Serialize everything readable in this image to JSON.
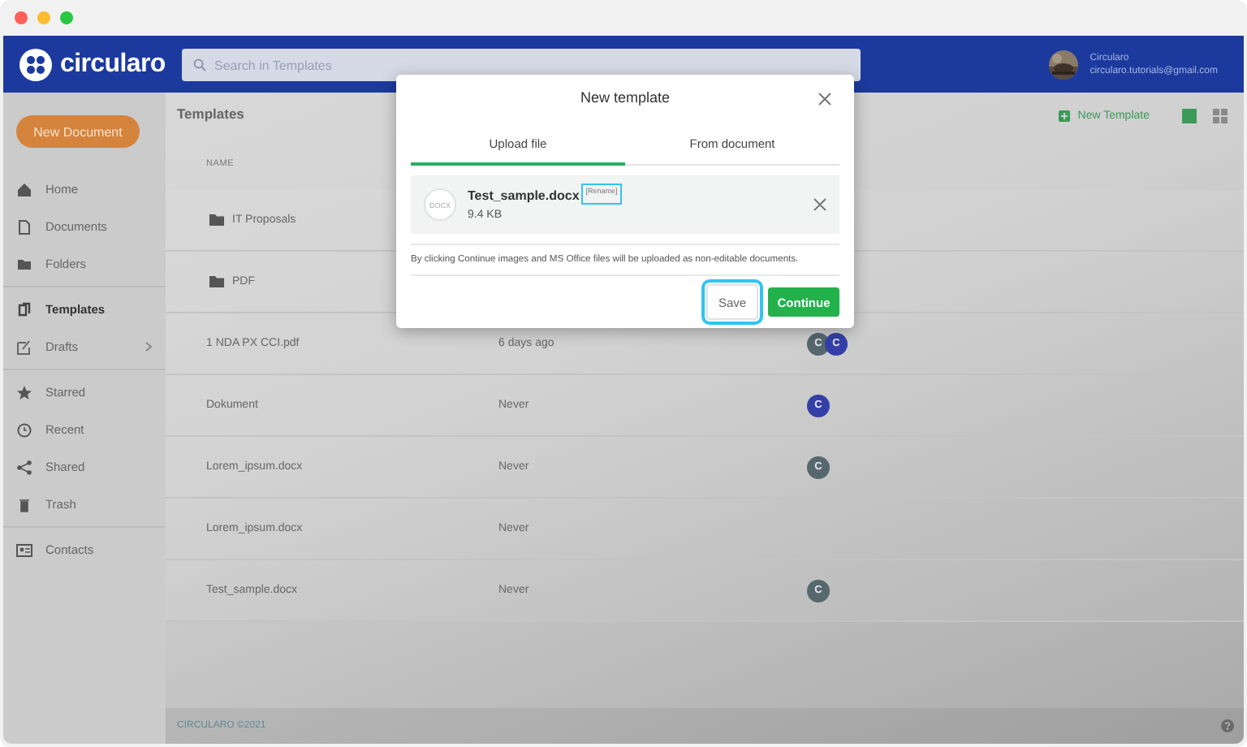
{
  "header": {
    "logo": "circularo",
    "search": {
      "placeholder": "Search in Templates"
    },
    "user": {
      "name": "Circularo",
      "email": "circularo.tutorials@gmail.com"
    }
  },
  "sidebar": {
    "new_button": "New Document",
    "groups": [
      [
        {
          "label": "Home",
          "selected": false,
          "expandable": false
        },
        {
          "label": "Documents",
          "selected": false,
          "expandable": false
        },
        {
          "label": "Folders",
          "selected": false,
          "expandable": false
        }
      ],
      [
        {
          "label": "Templates",
          "selected": true,
          "expandable": false
        },
        {
          "label": "Drafts",
          "selected": false,
          "expandable": true
        }
      ],
      [
        {
          "label": "Starred",
          "selected": false,
          "expandable": false
        },
        {
          "label": "Recent",
          "selected": false,
          "expandable": false
        },
        {
          "label": "Shared",
          "selected": false,
          "expandable": false
        },
        {
          "label": "Trash",
          "selected": false,
          "expandable": false
        }
      ],
      [
        {
          "label": "Contacts",
          "selected": false,
          "expandable": false
        }
      ]
    ]
  },
  "content": {
    "title": "Templates",
    "new_button": "New Template",
    "views": [
      {
        "kind": "list",
        "selected": true
      },
      {
        "kind": "grid",
        "selected": false
      }
    ]
  },
  "table": {
    "columns": [
      "NAME"
    ],
    "rows": [
      {
        "kind": "folder",
        "name": "IT Proposals"
      },
      {
        "kind": "folder",
        "name": "PDF"
      },
      {
        "kind": "file",
        "name": "1 NDA PX CCI.pdf",
        "modified": "6 days ago",
        "shared_with": [
          {
            "initial": "C",
            "color": "#56686e"
          },
          {
            "initial": "C",
            "color": "#3440a8"
          }
        ]
      },
      {
        "kind": "file",
        "name": "Dokument",
        "modified": "Never",
        "shared_with": [
          {
            "initial": "C",
            "color": "#3440a8"
          }
        ]
      },
      {
        "kind": "file",
        "name": "Lorem_ipsum.docx",
        "modified": "Never",
        "shared_with": [
          {
            "initial": "C",
            "color": "#56686e"
          }
        ]
      },
      {
        "kind": "file",
        "name": "Lorem_ipsum.docx",
        "modified": "Never",
        "shared_with": []
      },
      {
        "kind": "file",
        "name": "Test_sample.docx",
        "modified": "Never",
        "shared_with": [
          {
            "initial": "C",
            "color": "#56686e"
          }
        ]
      }
    ]
  },
  "footer": "CIRCULARO ©2021",
  "modal": {
    "title": "New template",
    "tabs": [
      {
        "label": "Upload file",
        "selected": true
      },
      {
        "label": "From document",
        "selected": false
      }
    ],
    "file": {
      "badge": "DOCX",
      "name": "Test_sample.docx",
      "rename": {
        "label": "[Rename]",
        "highlighted": true
      },
      "size": "9.4 KB"
    },
    "note": "By clicking Continue images and MS Office files will be uploaded as non-editable documents.",
    "buttons": [
      {
        "label": "Save",
        "kind": "secondary",
        "highlighted": true
      },
      {
        "label": "Continue",
        "kind": "primary",
        "highlighted": false
      }
    ]
  }
}
